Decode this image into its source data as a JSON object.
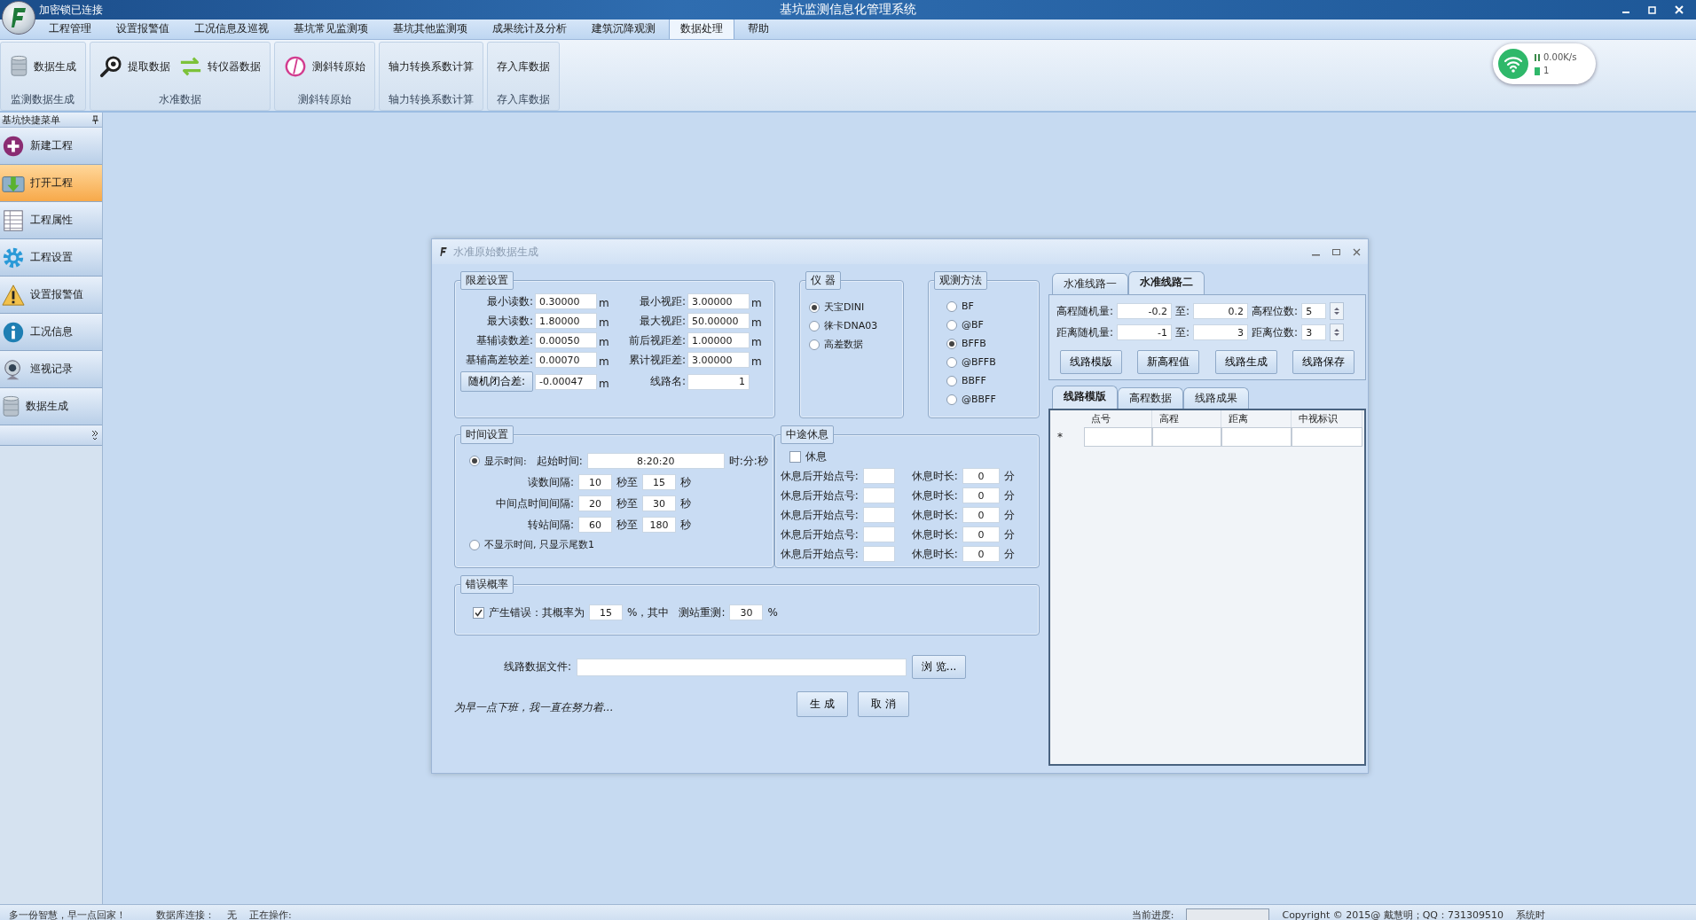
{
  "window": {
    "title": "基坑监测信息化管理系统",
    "lock_status": "加密锁已连接"
  },
  "menu": [
    {
      "label": "工程管理",
      "selected": false
    },
    {
      "label": "设置报警值",
      "selected": false
    },
    {
      "label": "工况信息及巡视",
      "selected": false
    },
    {
      "label": "基坑常见监测项",
      "selected": false
    },
    {
      "label": "基坑其他监测项",
      "selected": false
    },
    {
      "label": "成果统计及分析",
      "selected": false
    },
    {
      "label": "建筑沉降观测",
      "selected": false
    },
    {
      "label": "数据处理",
      "selected": true
    },
    {
      "label": "帮助",
      "selected": false
    }
  ],
  "ribbon": [
    {
      "title": "监测数据生成",
      "items": [
        {
          "label": "数据生成",
          "kind": "database"
        }
      ]
    },
    {
      "title": "水准数据",
      "items": [
        {
          "label": "提取数据",
          "kind": "magnifier"
        },
        {
          "label": "转仪器数据",
          "kind": "swap"
        }
      ]
    },
    {
      "title": "测斜转原始",
      "items": [
        {
          "label": "测斜转原始",
          "kind": "gauge"
        }
      ]
    },
    {
      "title": "轴力转换系数计算",
      "items": [
        {
          "label": "轴力转换系数计算",
          "kind": "text"
        }
      ]
    },
    {
      "title": "存入库数据",
      "items": [
        {
          "label": "存入库数据",
          "kind": "text"
        }
      ]
    }
  ],
  "network": {
    "speed": "0.00K/s",
    "count": "1"
  },
  "sidebar": {
    "title": "基坑快捷菜单",
    "items": [
      {
        "label": "新建工程",
        "kind": "plus",
        "selected": false
      },
      {
        "label": "打开工程",
        "kind": "folder",
        "selected": true
      },
      {
        "label": "工程属性",
        "kind": "sheet",
        "selected": false
      },
      {
        "label": "工程设置",
        "kind": "gear",
        "selected": false
      },
      {
        "label": "设置报警值",
        "kind": "warning",
        "selected": false
      },
      {
        "label": "工况信息",
        "kind": "info",
        "selected": false
      },
      {
        "label": "巡视记录",
        "kind": "camera",
        "selected": false
      },
      {
        "label": "数据生成",
        "kind": "database",
        "selected": false
      }
    ]
  },
  "dialog": {
    "title": "水准原始数据生成",
    "limits": {
      "title": "限差设置",
      "rows": [
        {
          "left": {
            "label": "最小读数:",
            "value": "0.30000",
            "unit": "m"
          },
          "right": {
            "label": "最小视距:",
            "value": "3.00000",
            "unit": "m"
          }
        },
        {
          "left": {
            "label": "最大读数:",
            "value": "1.80000",
            "unit": "m"
          },
          "right": {
            "label": "最大视距:",
            "value": "50.00000",
            "unit": "m"
          }
        },
        {
          "left": {
            "label": "基辅读数差:",
            "value": "0.00050",
            "unit": "m"
          },
          "right": {
            "label": "前后视距差:",
            "value": "1.00000",
            "unit": "m"
          }
        },
        {
          "left": {
            "label": "基辅高差较差:",
            "value": "0.00070",
            "unit": "m"
          },
          "right": {
            "label": "累计视距差:",
            "value": "3.00000",
            "unit": "m"
          }
        },
        {
          "left": {
            "label": "随机闭合差:",
            "value": "-0.00047",
            "unit": "m",
            "kind": "button"
          },
          "right": {
            "label": "线路名:",
            "value": "1"
          }
        }
      ]
    },
    "instrument": {
      "title": "仪 器",
      "options": [
        {
          "label": "天宝DINI",
          "selected": true
        },
        {
          "label": "徕卡DNA03",
          "selected": false
        },
        {
          "label": "高差数据",
          "selected": false
        }
      ]
    },
    "method": {
      "title": "观测方法",
      "options": [
        {
          "label": "BF",
          "selected": false
        },
        {
          "label": "@BF",
          "selected": false
        },
        {
          "label": "BFFB",
          "selected": true
        },
        {
          "label": "@BFFB",
          "selected": false
        },
        {
          "label": "BBFF",
          "selected": false
        },
        {
          "label": "@BBFF",
          "selected": false
        }
      ]
    },
    "time": {
      "title": "时间设置",
      "show_time": {
        "label": "显示时间:",
        "selected": true
      },
      "start": {
        "label": "起始时间:",
        "value": "8:20:20",
        "unit": "时:分:秒"
      },
      "intervals": [
        {
          "label": "读数间隔:",
          "from": "10",
          "mid": "秒至",
          "to": "15",
          "unit": "秒"
        },
        {
          "label": "中间点时间间隔:",
          "from": "20",
          "mid": "秒至",
          "to": "30",
          "unit": "秒"
        },
        {
          "label": "转站间隔:",
          "from": "60",
          "mid": "秒至",
          "to": "180",
          "unit": "秒"
        }
      ],
      "hide_time": {
        "label": "不显示时间, 只显示尾数1",
        "selected": false
      }
    },
    "rest": {
      "title": "中途休息",
      "checkbox": {
        "label": "休息",
        "checked": false
      },
      "rows": [
        {
          "label": "休息后开始点号:",
          "duration_label": "休息时长:",
          "duration": "0",
          "unit": "分"
        },
        {
          "label": "休息后开始点号:",
          "duration_label": "休息时长:",
          "duration": "0",
          "unit": "分"
        },
        {
          "label": "休息后开始点号:",
          "duration_label": "休息时长:",
          "duration": "0",
          "unit": "分"
        },
        {
          "label": "休息后开始点号:",
          "duration_label": "休息时长:",
          "duration": "0",
          "unit": "分"
        },
        {
          "label": "休息后开始点号:",
          "duration_label": "休息时长:",
          "duration": "0",
          "unit": "分"
        }
      ]
    },
    "error": {
      "title": "错误概率",
      "checkbox": {
        "label": "产生错误：其概率为",
        "checked": true
      },
      "value": "15",
      "mid": "%，其中",
      "label2": "测站重测:",
      "value2": "30",
      "unit": "%"
    },
    "file": {
      "label": "线路数据文件:",
      "browse": "浏 览..."
    },
    "note": "为早一点下班，我一直在努力着...",
    "buttons": [
      "生 成",
      "取 消"
    ],
    "panel": {
      "tabs": [
        {
          "label": "水准线路一",
          "selected": false
        },
        {
          "label": "水准线路二",
          "selected": true
        }
      ],
      "rows": [
        {
          "label": "高程随机量:",
          "from": "-0.2",
          "to_label": "至:",
          "to": "0.2",
          "digits_label": "高程位数:",
          "digits": "5"
        },
        {
          "label": "距离随机量:",
          "from": "-1",
          "to_label": "至:",
          "to": "3",
          "digits_label": "距离位数:",
          "digits": "3"
        }
      ],
      "buttons": [
        "线路模版",
        "新高程值",
        "线路生成",
        "线路保存"
      ],
      "subtabs": [
        {
          "label": "线路模版",
          "selected": true
        },
        {
          "label": "高程数据",
          "selected": false
        },
        {
          "label": "线路成果",
          "selected": false
        }
      ],
      "columns": [
        "点号",
        "高程",
        "距离",
        "中视标识"
      ],
      "new_row_marker": "*"
    }
  },
  "status_bar": {
    "message": "多一份智慧，早一点回家！",
    "db_label": "数据库连接：",
    "db_value": "无",
    "op_label": "正在操作:",
    "progress_label": "当前进度:",
    "progress": {
      "level": 0
    },
    "copyright": "Copyright © 2015@ 戴慧明；QQ：731309510",
    "time_label": "系统时"
  }
}
